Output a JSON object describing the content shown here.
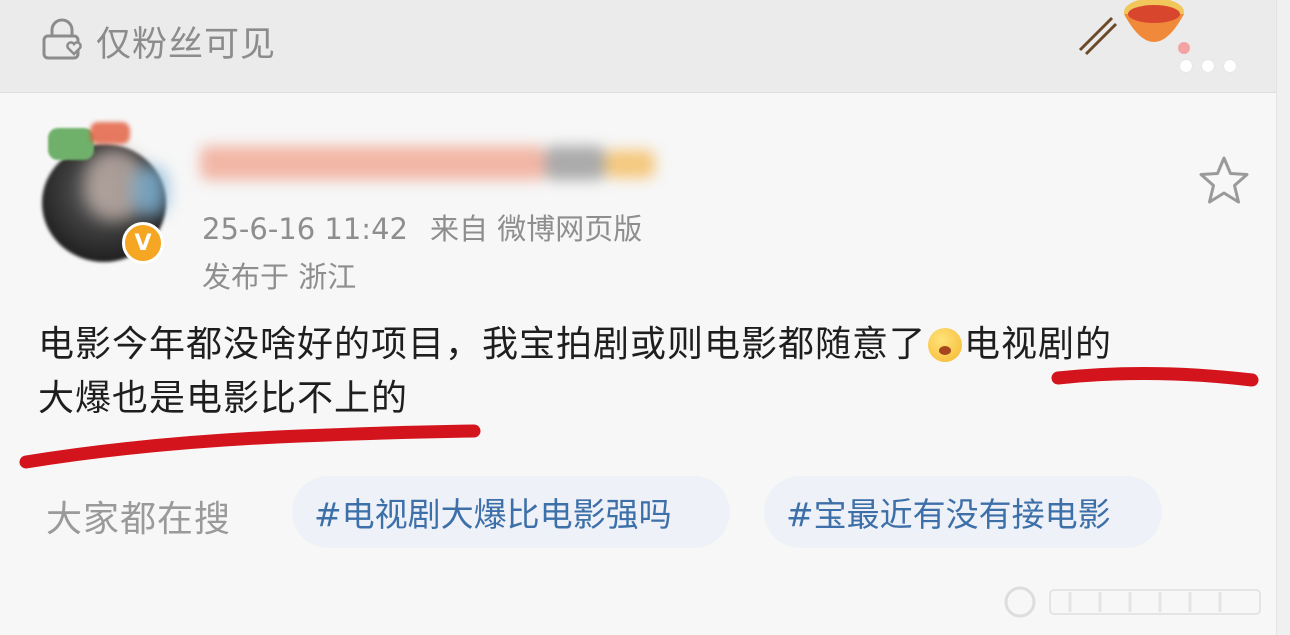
{
  "header": {
    "visibility_label": "仅粉丝可见",
    "lock_icon": "lock-heart-icon",
    "more_icon": "more-dots-icon"
  },
  "post": {
    "timestamp": "25-6-16 11:42",
    "source": "来自 微博网页版",
    "location": "发布于 浙江",
    "verified_badge": "V",
    "content_line1_a": "电影今年都没啥好的项目，我宝拍剧或则电影都随意了",
    "content_line1_b": "电视剧的",
    "content_line2": "大爆也是电影比不上的",
    "emoji_icon": "cry-emoji-icon"
  },
  "hot_search": {
    "label": "大家都在搜",
    "tags": [
      "#电视剧大爆比电影强吗",
      "#宝最近有没有接电影"
    ]
  },
  "colors": {
    "accent_tag_text": "#3d6fa8",
    "underline": "#d4141c",
    "verified": "#f5a623"
  }
}
